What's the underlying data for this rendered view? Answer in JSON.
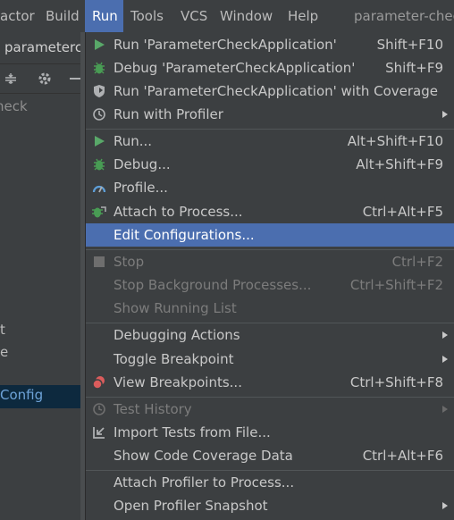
{
  "menubar": {
    "items": [
      {
        "label": "actor",
        "active": false
      },
      {
        "label": "Build",
        "active": false
      },
      {
        "label": "Run",
        "active": true
      },
      {
        "label": "Tools",
        "active": false
      },
      {
        "label": "VCS",
        "active": false
      },
      {
        "label": "Window",
        "active": false
      },
      {
        "label": "Help",
        "active": false
      }
    ],
    "window_title": "parameter-chec"
  },
  "left_panel": {
    "nav_tab": "parameterch",
    "path_fragment": "heck",
    "tree_letter_1": "t",
    "tree_letter_2": "e",
    "selected_config": "Config"
  },
  "run_menu": {
    "groups": [
      [
        {
          "label": "Run 'ParameterCheckApplication'",
          "shortcut": "Shift+F10",
          "icon": "run-triangle-icon",
          "submenu": false,
          "disabled": false,
          "selected": false
        },
        {
          "label": "Debug 'ParameterCheckApplication'",
          "shortcut": "Shift+F9",
          "icon": "debug-bug-icon",
          "submenu": false,
          "disabled": false,
          "selected": false
        },
        {
          "label": "Run 'ParameterCheckApplication' with Coverage",
          "shortcut": "",
          "icon": "coverage-shield-icon",
          "submenu": false,
          "disabled": false,
          "selected": false
        },
        {
          "label": "Run with Profiler",
          "shortcut": "",
          "icon": "profiler-clock-icon",
          "submenu": true,
          "disabled": false,
          "selected": false
        }
      ],
      [
        {
          "label": "Run...",
          "shortcut": "Alt+Shift+F10",
          "icon": "run-triangle-icon",
          "submenu": false,
          "disabled": false,
          "selected": false
        },
        {
          "label": "Debug...",
          "shortcut": "Alt+Shift+F9",
          "icon": "debug-bug-icon",
          "submenu": false,
          "disabled": false,
          "selected": false
        },
        {
          "label": "Profile...",
          "shortcut": "",
          "icon": "profile-gauge-icon",
          "submenu": false,
          "disabled": false,
          "selected": false
        },
        {
          "label": "Attach to Process...",
          "shortcut": "Ctrl+Alt+F5",
          "icon": "attach-bug-icon",
          "submenu": false,
          "disabled": false,
          "selected": false
        },
        {
          "label": "Edit Configurations...",
          "shortcut": "",
          "icon": "",
          "submenu": false,
          "disabled": false,
          "selected": true
        }
      ],
      [
        {
          "label": "Stop",
          "shortcut": "Ctrl+F2",
          "icon": "stop-square-icon",
          "submenu": false,
          "disabled": true,
          "selected": false
        },
        {
          "label": "Stop Background Processes...",
          "shortcut": "Ctrl+Shift+F2",
          "icon": "",
          "submenu": false,
          "disabled": true,
          "selected": false
        },
        {
          "label": "Show Running List",
          "shortcut": "",
          "icon": "",
          "submenu": false,
          "disabled": true,
          "selected": false
        }
      ],
      [
        {
          "label": "Debugging Actions",
          "shortcut": "",
          "icon": "",
          "submenu": true,
          "disabled": false,
          "selected": false
        },
        {
          "label": "Toggle Breakpoint",
          "shortcut": "",
          "icon": "",
          "submenu": true,
          "disabled": false,
          "selected": false
        },
        {
          "label": "View Breakpoints...",
          "shortcut": "Ctrl+Shift+F8",
          "icon": "breakpoints-icon",
          "submenu": false,
          "disabled": false,
          "selected": false
        }
      ],
      [
        {
          "label": "Test History",
          "shortcut": "",
          "icon": "history-clock-icon",
          "submenu": true,
          "disabled": true,
          "selected": false
        },
        {
          "label": "Import Tests from File...",
          "shortcut": "",
          "icon": "import-arrow-icon",
          "submenu": false,
          "disabled": false,
          "selected": false
        },
        {
          "label": "Show Code Coverage Data",
          "shortcut": "Ctrl+Alt+F6",
          "icon": "",
          "submenu": false,
          "disabled": false,
          "selected": false
        }
      ],
      [
        {
          "label": "Attach Profiler to Process...",
          "shortcut": "",
          "icon": "",
          "submenu": false,
          "disabled": false,
          "selected": false
        },
        {
          "label": "Open Profiler Snapshot",
          "shortcut": "",
          "icon": "",
          "submenu": true,
          "disabled": false,
          "selected": false
        }
      ]
    ]
  },
  "colors": {
    "background": "#3c3f41",
    "selection": "#4b6eaf",
    "run_green": "#59a869",
    "debug_green": "#499c54",
    "breakpoint_red": "#db5c5c",
    "config_text": "#6ea3d8"
  }
}
